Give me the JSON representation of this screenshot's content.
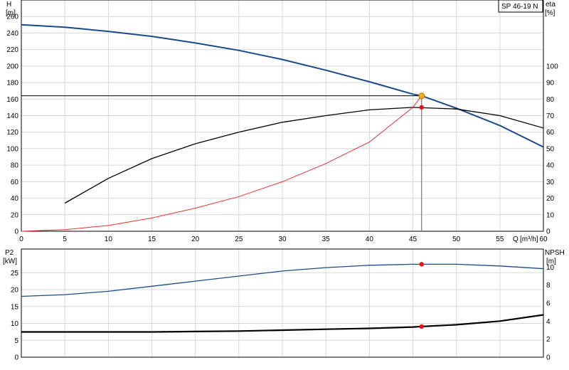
{
  "chart_data": [
    {
      "type": "line",
      "model": "SP 46-19 N",
      "x_axis": {
        "label": "Q",
        "unit": "[m³/h]",
        "range": [
          0,
          60
        ],
        "ticks": [
          0,
          5,
          10,
          15,
          20,
          25,
          30,
          35,
          40,
          45,
          50,
          55,
          60
        ]
      },
      "y_left": {
        "label": "H",
        "unit": "[m]",
        "range": [
          0,
          280
        ],
        "ticks": [
          0,
          20,
          40,
          60,
          80,
          100,
          120,
          140,
          160,
          180,
          200,
          220,
          240,
          260
        ]
      },
      "y_right": {
        "label": "eta",
        "unit": "[%]",
        "range": [
          0,
          140
        ],
        "ticks": [
          0,
          10,
          20,
          30,
          40,
          50,
          60,
          70,
          80,
          90,
          100
        ]
      },
      "grid": true,
      "series": [
        {
          "axis": "left",
          "color": "#1a4a8a",
          "x": [
            0,
            5,
            10,
            15,
            20,
            25,
            30,
            35,
            40,
            45,
            46,
            50,
            55,
            60
          ],
          "y": [
            250,
            247,
            242,
            236,
            228,
            219,
            208,
            195,
            181,
            166,
            164,
            149,
            128,
            102
          ]
        },
        {
          "axis": "right",
          "color": "#000000",
          "x": [
            5,
            10,
            15,
            20,
            25,
            30,
            35,
            40,
            45,
            50,
            55,
            60
          ],
          "y": [
            17,
            32,
            44,
            53,
            60,
            66,
            70,
            73.5,
            75,
            74,
            70,
            62.5
          ]
        },
        {
          "axis": "left",
          "color": "#e83030",
          "x": [
            0,
            5,
            10,
            15,
            20,
            25,
            30,
            35,
            40,
            45,
            46
          ],
          "y": [
            0,
            2,
            7,
            16,
            28,
            42,
            60,
            82,
            108,
            150,
            164
          ]
        }
      ],
      "duty_point": {
        "q": 46,
        "h": 164,
        "eta": 75
      }
    },
    {
      "type": "line",
      "x_axis": {
        "range": [
          0,
          60
        ]
      },
      "y_left": {
        "label": "P2",
        "unit": "[kW]",
        "range": [
          0,
          32
        ],
        "ticks": [
          0,
          5,
          10,
          15,
          20,
          25
        ]
      },
      "y_right": {
        "label": "NPSH",
        "unit": "[m]",
        "range": [
          0,
          12
        ],
        "ticks": [
          0,
          2,
          4,
          6,
          8,
          10
        ]
      },
      "grid": true,
      "series": [
        {
          "axis": "left",
          "color": "#1a4a8a",
          "x": [
            0,
            5,
            10,
            15,
            20,
            25,
            30,
            35,
            40,
            45,
            46,
            50,
            55,
            60
          ],
          "y": [
            18,
            18.5,
            19.5,
            21,
            22.5,
            24,
            25.5,
            26.5,
            27.2,
            27.5,
            27.5,
            27.5,
            27,
            26.2
          ]
        },
        {
          "axis": "right",
          "color": "#000000",
          "x": [
            0,
            5,
            10,
            15,
            20,
            25,
            30,
            35,
            40,
            45,
            46,
            50,
            55,
            60
          ],
          "y": [
            2.8,
            2.8,
            2.8,
            2.8,
            2.85,
            2.9,
            3.0,
            3.1,
            3.2,
            3.35,
            3.4,
            3.6,
            4.0,
            4.7
          ]
        }
      ],
      "duty_points": [
        {
          "q": 46,
          "p2": 27.5
        },
        {
          "q": 46,
          "npsh": 3.4
        }
      ]
    }
  ]
}
